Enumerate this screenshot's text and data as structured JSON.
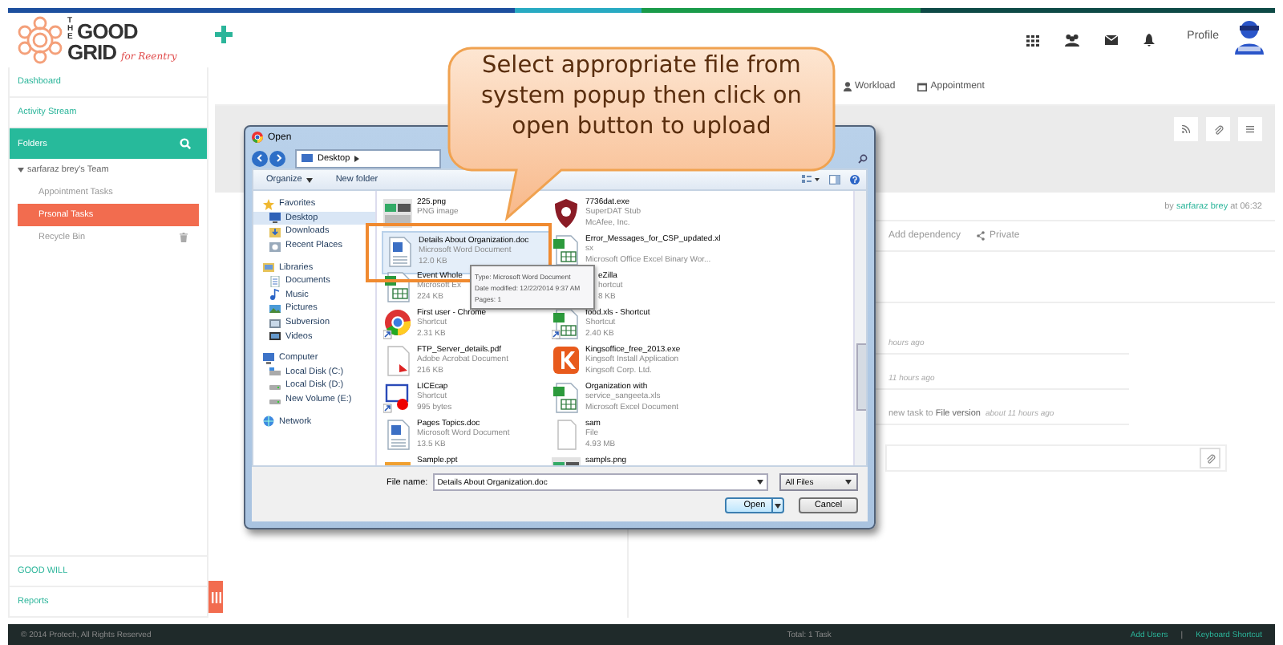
{
  "logo": {
    "small": "THE",
    "top": "GOOD",
    "bottom": "GRID",
    "tagline": "for Reentry"
  },
  "header": {
    "profile": "Profile"
  },
  "sidebar": {
    "top": [
      {
        "label": "Dashboard"
      },
      {
        "label": "Activity Stream"
      }
    ],
    "folders": {
      "title": "Folders",
      "team": "sarfaraz brey's Team",
      "expanded": true,
      "items": [
        {
          "label": "Appointment Tasks",
          "selected": false,
          "trash": false
        },
        {
          "label": "Prsonal Tasks",
          "selected": true,
          "trash": false
        },
        {
          "label": "Recycle Bin",
          "selected": false,
          "trash": true
        }
      ]
    },
    "bottom": [
      {
        "label": "GOOD WILL"
      },
      {
        "label": "Reports"
      }
    ]
  },
  "tabs": [
    {
      "label": "Workload",
      "kind": "user"
    },
    {
      "label": "Appointment",
      "kind": "calendar"
    }
  ],
  "task": {
    "by": "by",
    "author": "sarfaraz brey",
    "at": "at 06:32",
    "actions": [
      {
        "label": "Add dependency",
        "kind": "none"
      },
      {
        "label": "Private",
        "kind": "share"
      }
    ]
  },
  "activity": [
    {
      "time": "hours ago"
    },
    {
      "time": "11 hours ago"
    },
    {
      "text": "new task to **File version**",
      "time": "about 11 hours ago"
    }
  ],
  "footer": {
    "copyright": "© 2014 Protech, All Rights Reserved",
    "total": "Total: 1 Task",
    "links": [
      "Add Users",
      "Keyboard Shortcut"
    ],
    "separator": "|"
  },
  "dialog": {
    "title": "Open",
    "path": "Desktop",
    "toolbar": [
      {
        "label": "Organize",
        "dropdown": true
      },
      {
        "label": "New folder",
        "dropdown": false
      }
    ],
    "nav": [
      {
        "label": "Favorites",
        "kind": "star",
        "selected": false,
        "children": [
          {
            "label": "Desktop",
            "kind": "desktop",
            "selected": true
          },
          {
            "label": "Downloads",
            "kind": "download",
            "selected": false
          },
          {
            "label": "Recent Places",
            "kind": "recent",
            "selected": false
          }
        ]
      },
      {
        "label": "Libraries",
        "kind": "library",
        "selected": false,
        "children": [
          {
            "label": "Documents",
            "kind": "doc",
            "selected": false
          },
          {
            "label": "Music",
            "kind": "music",
            "selected": false
          },
          {
            "label": "Pictures",
            "kind": "picture",
            "selected": false
          },
          {
            "label": "Subversion",
            "kind": "svn",
            "selected": false
          },
          {
            "label": "Videos",
            "kind": "video",
            "selected": false
          }
        ]
      },
      {
        "label": "Computer",
        "kind": "computer",
        "selected": false,
        "children": [
          {
            "label": "Local Disk (C:)",
            "kind": "disk",
            "selected": false
          },
          {
            "label": "Local Disk (D:)",
            "kind": "drive",
            "selected": false
          },
          {
            "label": "New Volume (E:)",
            "kind": "drive",
            "selected": false
          }
        ]
      },
      {
        "label": "Network",
        "kind": "network",
        "selected": false
      }
    ],
    "files": [
      {
        "name": "225.png",
        "lines": [
          "PNG image"
        ],
        "kind": "image",
        "shortcut": false,
        "selected": false
      },
      {
        "name": "7736dat.exe",
        "lines": [
          "SuperDAT Stub",
          "McAfee, Inc."
        ],
        "kind": "shield",
        "shortcut": false,
        "selected": false
      },
      {
        "name": "Details About Organization.doc",
        "lines": [
          "Microsoft Word Document",
          "12.0 KB"
        ],
        "kind": "word",
        "shortcut": false,
        "selected": true
      },
      {
        "name": "Error_Messages_for_CSP_updated.xl",
        "lines": [
          "sx",
          "Microsoft Office Excel Binary Wor..."
        ],
        "kind": "excel",
        "shortcut": false,
        "selected": false
      },
      {
        "name": "Event Whole",
        "lines": [
          "Microsoft Ex",
          "224 KB"
        ],
        "kind": "excel",
        "shortcut": false,
        "selected": false
      },
      {
        "name": "eZilla",
        "lines": [
          "hortcut",
          "8 KB"
        ],
        "kind": "none",
        "selected": false
      },
      {
        "name": "First user - Chrome",
        "lines": [
          "Shortcut",
          "2.31 KB"
        ],
        "kind": "chrome",
        "shortcut": true,
        "selected": false
      },
      {
        "name": "food.xls - Shortcut",
        "lines": [
          "Shortcut",
          "2.40 KB"
        ],
        "kind": "excel",
        "shortcut": true,
        "selected": false
      },
      {
        "name": "FTP_Server_details.pdf",
        "lines": [
          "Adobe Acrobat Document",
          "216 KB"
        ],
        "kind": "pdf",
        "shortcut": false,
        "selected": false
      },
      {
        "name": "Kingsoffice_free_2013.exe",
        "lines": [
          "Kingsoft Install Application",
          "Kingsoft Corp. Ltd."
        ],
        "kind": "kingsoft",
        "shortcut": false,
        "selected": false
      },
      {
        "name": "LICEcap",
        "lines": [
          "Shortcut",
          "995 bytes"
        ],
        "kind": "capture",
        "shortcut": true,
        "selected": false
      },
      {
        "name": "Organization with",
        "lines": [
          "service_sangeeta.xls",
          "Microsoft Excel Document"
        ],
        "kind": "excel",
        "shortcut": false,
        "selected": false
      },
      {
        "name": "Pages Topics.doc",
        "lines": [
          "Microsoft Word Document",
          "13.5 KB"
        ],
        "kind": "word",
        "shortcut": false,
        "selected": false
      },
      {
        "name": "sam",
        "lines": [
          "File",
          "4.93 MB"
        ],
        "kind": "blank",
        "shortcut": false,
        "selected": false
      },
      {
        "name": "Sample.ppt",
        "kind": "ppt",
        "selected": false
      },
      {
        "name": "sampls.png",
        "kind": "image",
        "selected": false
      }
    ],
    "tooltip": [
      "Type: Microsoft Word Document",
      "Date modified: 12/22/2014 9:37 AM",
      "Pages: 1"
    ],
    "filename_label": "File name:",
    "filename": "Details About Organization.doc",
    "filter": "All Files",
    "buttons": [
      {
        "label": "Open",
        "default": true,
        "split": true
      },
      {
        "label": "Cancel",
        "default": false,
        "split": false
      }
    ]
  },
  "callout": "Select appropriate file from system popup then click on open button to upload"
}
